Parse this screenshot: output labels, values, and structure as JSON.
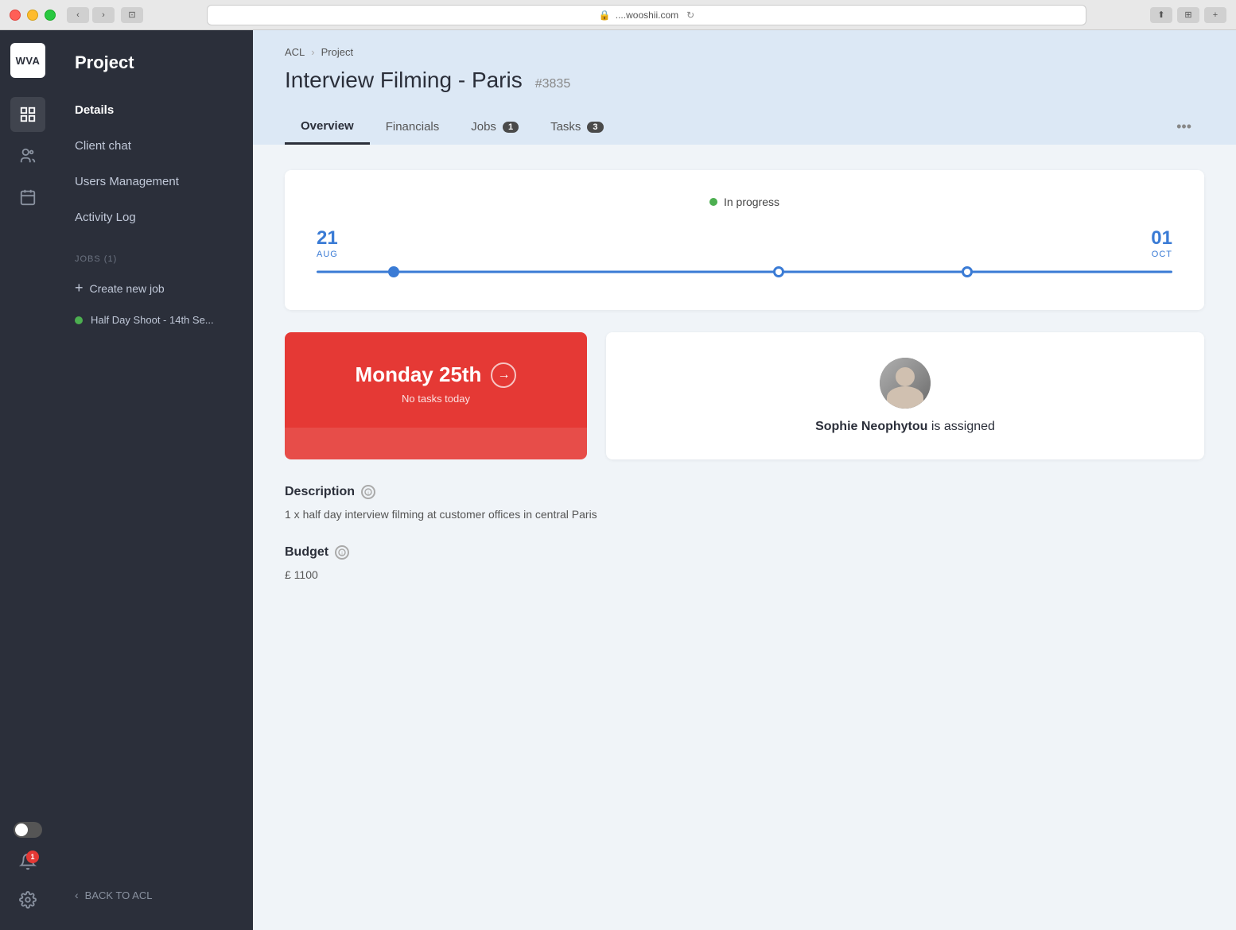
{
  "window": {
    "url": "....wooshii.com",
    "reload_icon": "↻"
  },
  "logo": "WVA",
  "sidebar": {
    "title": "Project",
    "nav_items": [
      {
        "id": "details",
        "label": "Details",
        "active": true
      },
      {
        "id": "client-chat",
        "label": "Client chat",
        "active": false
      },
      {
        "id": "users-management",
        "label": "Users Management",
        "active": false
      },
      {
        "id": "activity-log",
        "label": "Activity Log",
        "active": false
      }
    ],
    "jobs_section_label": "JOBS (1)",
    "create_job_label": "Create new job",
    "jobs": [
      {
        "id": "job-1",
        "label": "Half Day Shoot - 14th Se...",
        "status": "active"
      }
    ],
    "back_label": "BACK TO ACL"
  },
  "breadcrumb": {
    "items": [
      "ACL",
      "Project"
    ],
    "separator": "›"
  },
  "project": {
    "title": "Interview Filming - Paris",
    "id": "#3835"
  },
  "tabs": [
    {
      "id": "overview",
      "label": "Overview",
      "badge": null,
      "active": true
    },
    {
      "id": "financials",
      "label": "Financials",
      "badge": null,
      "active": false
    },
    {
      "id": "jobs",
      "label": "Jobs",
      "badge": "1",
      "active": false
    },
    {
      "id": "tasks",
      "label": "Tasks",
      "badge": "3",
      "active": false
    }
  ],
  "tabs_more": "•••",
  "timeline": {
    "status": "In progress",
    "start_date_num": "21",
    "start_date_mon": "AUG",
    "end_date_num": "01",
    "end_date_mon": "OCT"
  },
  "date_card": {
    "title": "Monday 25th",
    "subtitle": "No tasks today",
    "arrow": "→"
  },
  "assigned": {
    "name": "Sophie Neophytou",
    "status": "is assigned"
  },
  "description": {
    "label": "Description",
    "value": "1 x half day interview filming at customer offices in central Paris"
  },
  "budget": {
    "label": "Budget",
    "value": "£ 1100"
  },
  "notifications_count": "1",
  "toggle": {
    "on": false
  }
}
